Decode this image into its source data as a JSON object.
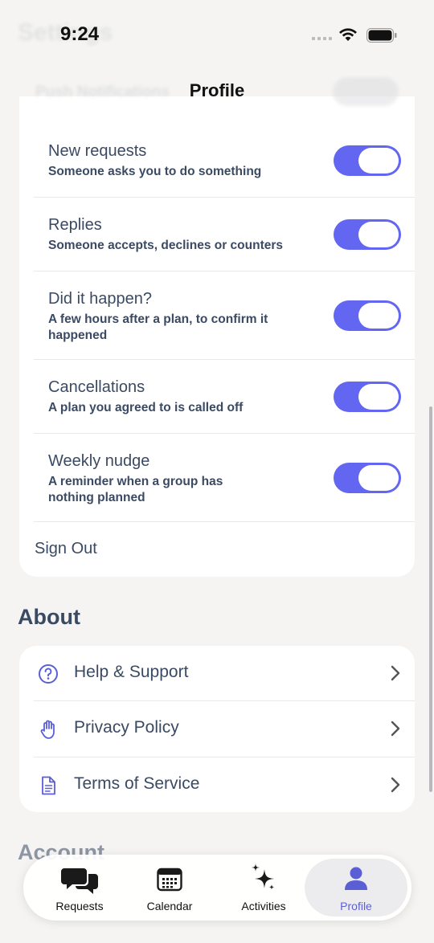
{
  "status_bar": {
    "time": "9:24",
    "background_title": "Settings"
  },
  "nav": {
    "title": "Profile",
    "ghost_label": "Push Notifications"
  },
  "notifications": [
    {
      "title": "New requests",
      "subtitle": "Someone asks you to do something",
      "enabled": true
    },
    {
      "title": "Replies",
      "subtitle": "Someone accepts, declines or counters",
      "enabled": true
    },
    {
      "title": "Did it happen?",
      "subtitle": "A few hours after a plan, to confirm it happened",
      "enabled": true
    },
    {
      "title": "Cancellations",
      "subtitle": "A plan you agreed to is called off",
      "enabled": true
    },
    {
      "title": "Weekly nudge",
      "subtitle": "A reminder when a group has nothing planned",
      "enabled": true
    }
  ],
  "sign_out": "Sign Out",
  "about": {
    "title": "About",
    "items": [
      {
        "label": "Help & Support",
        "icon": "question-circle-icon"
      },
      {
        "label": "Privacy Policy",
        "icon": "hand-icon"
      },
      {
        "label": "Terms of Service",
        "icon": "document-icon"
      }
    ]
  },
  "account_title": "Account",
  "tabs": [
    {
      "label": "Requests",
      "icon": "chat-bubbles-icon",
      "active": false
    },
    {
      "label": "Calendar",
      "icon": "calendar-icon",
      "active": false
    },
    {
      "label": "Activities",
      "icon": "sparkles-icon",
      "active": false
    },
    {
      "label": "Profile",
      "icon": "person-icon",
      "active": true
    }
  ],
  "colors": {
    "accent": "#6366f1",
    "text": "#3b4a63",
    "background": "#f5f4f2"
  }
}
